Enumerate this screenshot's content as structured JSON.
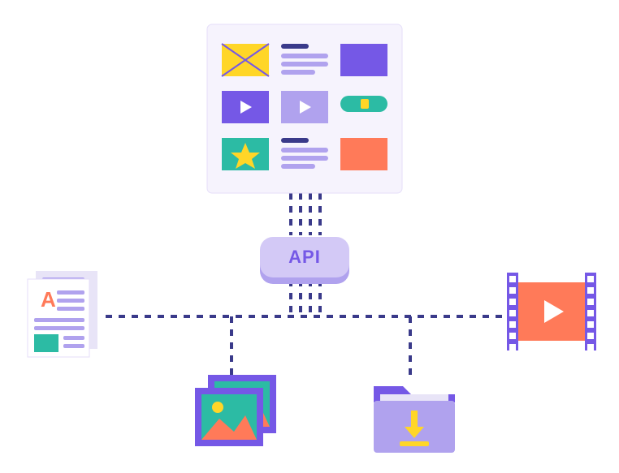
{
  "hub": {
    "label": "API"
  },
  "nodes": {
    "gallery": {
      "items": [
        {
          "type": "envelope"
        },
        {
          "type": "text-lines"
        },
        {
          "type": "solid-purple"
        },
        {
          "type": "video-purple"
        },
        {
          "type": "video-lavender"
        },
        {
          "type": "switch-green"
        },
        {
          "type": "star-teal"
        },
        {
          "type": "text-lines"
        },
        {
          "type": "solid-orange"
        }
      ]
    },
    "document": {
      "letter": "A"
    },
    "video": {
      "type": "film-strip"
    },
    "images": {
      "type": "photo-stack"
    },
    "folder": {
      "type": "download-folder"
    }
  },
  "colors": {
    "purple": "#7558e6",
    "lavender": "#b0a2ee",
    "paleLavender": "#d3c9f6",
    "panelBg": "#f6f3fd",
    "yellow": "#ffd627",
    "teal": "#2cbba4",
    "orange": "#ff7a59",
    "navy": "#3a3a8a",
    "darkText": "#2b2266"
  }
}
